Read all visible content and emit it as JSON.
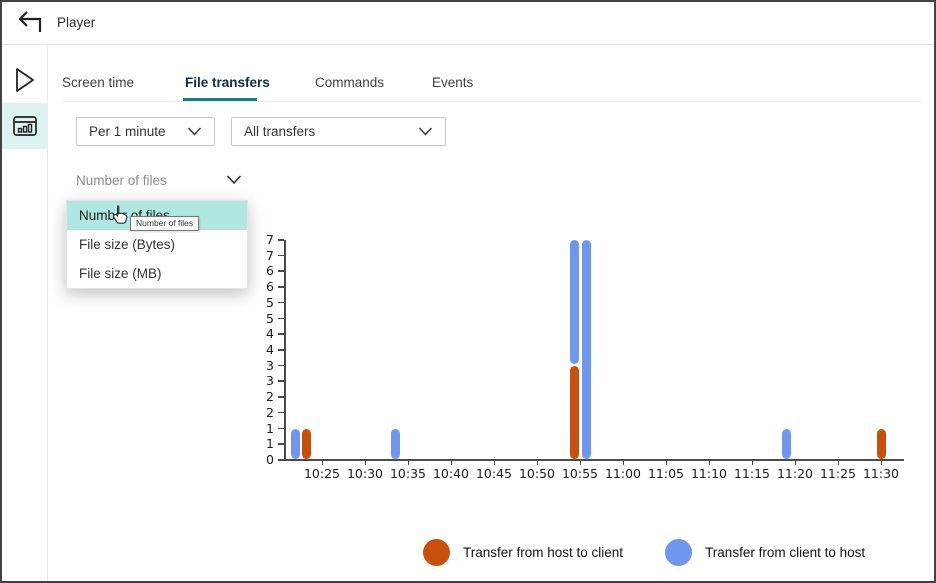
{
  "header": {
    "title": "Player"
  },
  "sidebar": {
    "items": [
      {
        "icon": "play-icon",
        "selected": false
      },
      {
        "icon": "stats-icon",
        "selected": true
      }
    ]
  },
  "tabs": [
    {
      "label": "Screen time",
      "active": false
    },
    {
      "label": "File transfers",
      "active": true
    },
    {
      "label": "Commands",
      "active": false
    },
    {
      "label": "Events",
      "active": false
    }
  ],
  "filters": {
    "interval": {
      "value": "Per 1 minute"
    },
    "transfer_type": {
      "value": "All transfers"
    },
    "metric": {
      "value": "Number of files"
    }
  },
  "metric_menu": {
    "items": [
      {
        "label": "Number of files",
        "highlighted": true
      },
      {
        "label": "File size (Bytes)",
        "highlighted": false
      },
      {
        "label": "File size (MB)",
        "highlighted": false
      }
    ],
    "tooltip": "Number of files"
  },
  "colors": {
    "accent_teal": "#1a7b8c",
    "sidebar_selected_bg": "#ddf3f1",
    "menu_highlight_bg": "#b0e7e0",
    "host_to_client_orange": "#c8500a",
    "client_to_host_blue": "#6f97ef"
  },
  "chart_data": {
    "type": "bar",
    "title": "",
    "xlabel": "",
    "ylabel": "",
    "y_axis": {
      "min": 0,
      "max": 7,
      "tick_step": 0.5,
      "labels_bottom_to_top": [
        "0",
        "1",
        "1",
        "2",
        "2",
        "3",
        "3",
        "4",
        "4",
        "5",
        "5",
        "6",
        "6",
        "7",
        "7"
      ]
    },
    "x_axis": {
      "ticks": [
        {
          "t": 25,
          "label": "10:25"
        },
        {
          "t": 30,
          "label": "10:30"
        },
        {
          "t": 35,
          "label": "10:35"
        },
        {
          "t": 40,
          "label": "10:40"
        },
        {
          "t": 45,
          "label": "10:45"
        },
        {
          "t": 50,
          "label": "10:50"
        },
        {
          "t": 55,
          "label": "10:55"
        },
        {
          "t": 60,
          "label": "11:00"
        },
        {
          "t": 65,
          "label": "11:05"
        },
        {
          "t": 70,
          "label": "11:10"
        },
        {
          "t": 75,
          "label": "11:15"
        },
        {
          "t": 80,
          "label": "11:20"
        },
        {
          "t": 85,
          "label": "11:25"
        },
        {
          "t": 90,
          "label": "11:30"
        }
      ]
    },
    "series": [
      {
        "id": "host_to_client",
        "name": "Transfer from host to client",
        "color": "#c8500a"
      },
      {
        "id": "client_to_host",
        "name": "Transfer from client to host",
        "color": "#6f97ef"
      }
    ],
    "bars": [
      {
        "time": "10:22",
        "t": 21.9,
        "segments": [
          {
            "series": "client_to_host",
            "value": 1
          }
        ]
      },
      {
        "time": "10:23",
        "t": 23.2,
        "segments": [
          {
            "series": "host_to_client",
            "value": 1
          }
        ]
      },
      {
        "time": "10:34",
        "t": 33.5,
        "segments": [
          {
            "series": "client_to_host",
            "value": 1
          }
        ]
      },
      {
        "time": "10:54",
        "t": 54.4,
        "segments": [
          {
            "series": "host_to_client",
            "value": 3
          },
          {
            "series": "client_to_host",
            "value": 4
          }
        ]
      },
      {
        "time": "10:56",
        "t": 55.7,
        "segments": [
          {
            "series": "client_to_host",
            "value": 7
          }
        ]
      },
      {
        "time": "11:19",
        "t": 79.0,
        "segments": [
          {
            "series": "client_to_host",
            "value": 1
          }
        ]
      },
      {
        "time": "11:30",
        "t": 90.0,
        "segments": [
          {
            "series": "host_to_client",
            "value": 1
          }
        ]
      }
    ],
    "legend": [
      "Transfer from host to client",
      "Transfer from client to host"
    ],
    "legend_position": "bottom",
    "grid": false
  }
}
